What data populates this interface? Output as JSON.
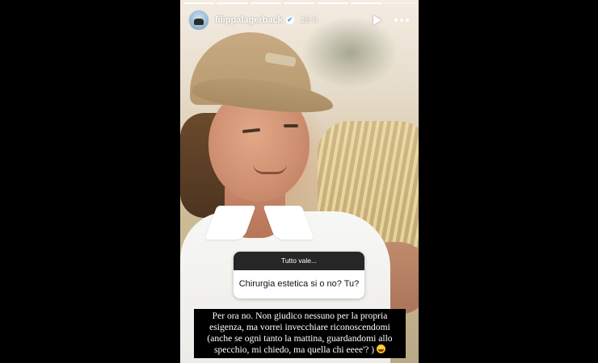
{
  "story": {
    "username": "filippalagerback",
    "verified_mark": "✔",
    "time_ago": "18 h",
    "progress": {
      "segments_total": 7,
      "segments_done": 6
    },
    "icons": {
      "play": "play-icon",
      "more": "more-icon",
      "verified": "verified-icon",
      "emoji": "laughing-emoji-icon"
    }
  },
  "question_sticker": {
    "prompt": "Tutto vale...",
    "question": "Chirurgia estetica si o no? Tu?"
  },
  "answer": {
    "line1": "Per ora no. Non giudico nessuno per la propria",
    "line2": "esigenza, ma vorrei invecchiare riconoscendomi",
    "line3": "(anche se ogni tanto la mattina, guardandomi allo",
    "line4": "specchio,  mi chiedo, ma quella chi eeee'? )"
  },
  "colors": {
    "page_background": "#000000",
    "sticker_header": "#262626",
    "sticker_body": "#ffffff",
    "caption_background": "#000000",
    "verified": "#3897f0"
  }
}
